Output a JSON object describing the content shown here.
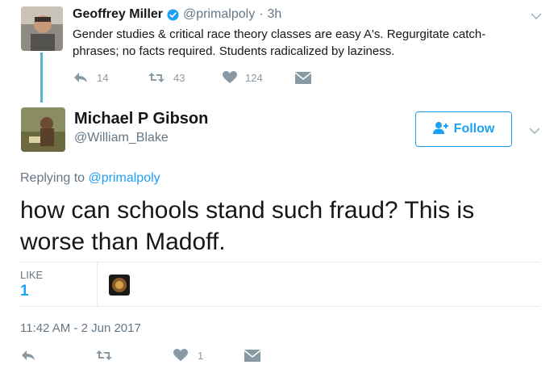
{
  "parent_tweet": {
    "author_name": "Geoffrey Miller",
    "handle": "@primalpoly",
    "separator": "·",
    "time": "3h",
    "text_line1": "Gender studies & critical race theory classes are easy A's. Regurgitate catch-",
    "text_line2": "phrases; no facts required. Students radicalized by laziness.",
    "replies": "14",
    "retweets": "43",
    "likes": "124"
  },
  "main_tweet": {
    "author_name": "Michael P Gibson",
    "handle": "@William_Blake",
    "follow_label": "Follow",
    "replying_prefix": "Replying to",
    "replying_handle": "@primalpoly",
    "text_line1": "how can schools stand such fraud? This is",
    "text_line2": "worse than Madoff.",
    "likes_label": "LIKE",
    "likes_count": "1",
    "timestamp": "11:42 AM - 2 Jun 2017",
    "bottom_likes": "1"
  },
  "icons": {
    "verified": "verified-badge-icon",
    "reply": "reply-icon",
    "retweet": "retweet-icon",
    "like": "heart-icon",
    "dm": "envelope-icon",
    "more": "chevron-down-icon",
    "follow": "add-user-icon"
  },
  "colors": {
    "accent": "#1da1f2",
    "thread_line": "#5fb0d5",
    "muted": "#657786",
    "icon_gray": "#8899a6"
  }
}
